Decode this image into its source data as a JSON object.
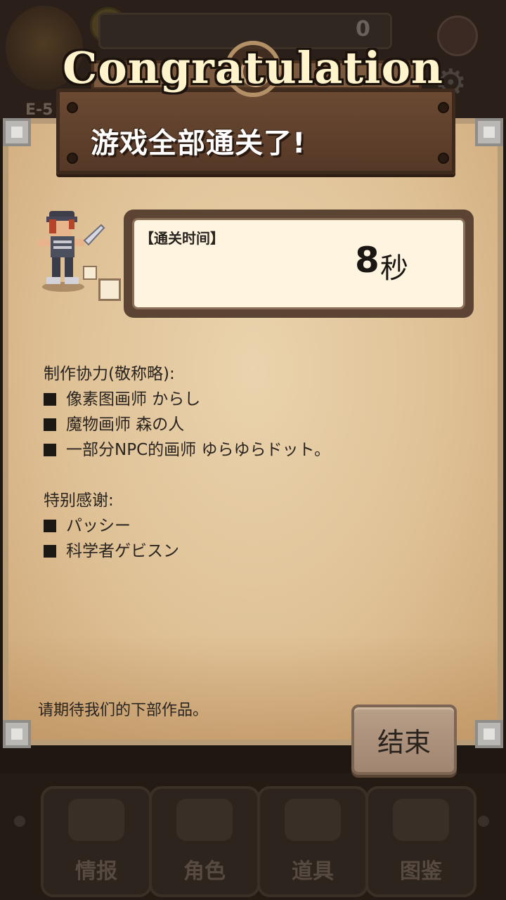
{
  "background": {
    "counter_value": "0",
    "stage_label": "E-5",
    "tabs": [
      {
        "label": "情报"
      },
      {
        "label": "角色"
      },
      {
        "label": "道具"
      },
      {
        "label": "图鉴"
      }
    ]
  },
  "dialog": {
    "banner": "Congratulation",
    "title": "游戏全部通关了!",
    "clear_time": {
      "label": "【通关时间】",
      "value": "8",
      "unit": "秒"
    },
    "credits_heading": "制作协力(敬称略):",
    "credits": [
      "像素图画师 からし",
      "魔物画师 森の人",
      "一部分NPC的画师 ゆらゆらドット。"
    ],
    "thanks_heading": "特别感谢:",
    "thanks": [
      "パッシー",
      "科学者ゲビスン"
    ],
    "footer_message": "请期待我们的下部作品。",
    "end_button": "结束"
  }
}
